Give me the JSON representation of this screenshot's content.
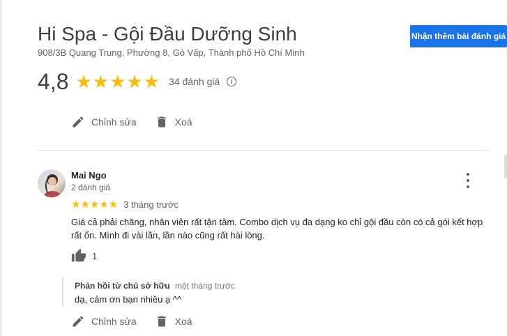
{
  "business": {
    "name": "Hi Spa - Gội Đầu Dưỡng Sinh",
    "address": "908/3B Quang Trung, Phường 8, Gò Vấp, Thành phố Hồ Chí Minh",
    "rating": "4,8",
    "stars": "★★★★★",
    "review_count": "34 đánh giá",
    "cta_label": "Nhận thêm bài đánh giá"
  },
  "actions": {
    "edit_label": "Chỉnh sửa",
    "delete_label": "Xoá"
  },
  "review": {
    "reviewer": "Mai Ngo",
    "reviewer_meta": "2 đánh giá",
    "stars": "★★★★★",
    "time": "3 tháng trước",
    "text": "Giá cả phải chăng, nhân viên rất tận tâm. Combo dịch vụ đa dạng ko chỉ gội đầu còn có cả gói kết hợp rất ổn. Mình đi vài lần, lần nào cũng rất hài lòng.",
    "likes": "1"
  },
  "owner_reply": {
    "label": "Phản hồi từ chủ sở hữu",
    "time": "một tháng trước",
    "text": "dạ, cảm ơn bạn nhiều ạ ^^"
  },
  "colors": {
    "accent": "#1a73e8",
    "star": "#fbbc04",
    "icon": "#5f6368"
  },
  "icons": [
    "pencil-icon",
    "trash-icon",
    "info-icon",
    "more-vert-icon",
    "thumb-up-icon"
  ]
}
